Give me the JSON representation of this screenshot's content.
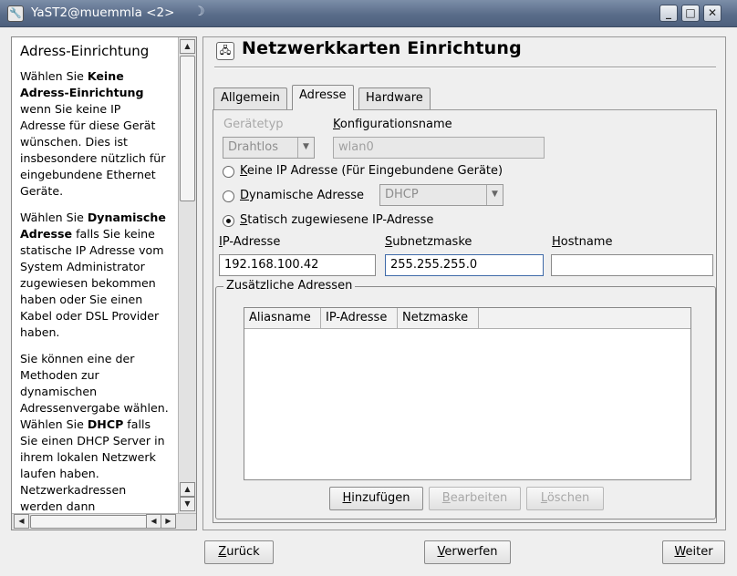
{
  "window": {
    "title": "YaST2@muemmla <2>",
    "app_icon": "yast-icon",
    "controls": {
      "minimize": "_",
      "maximize": "□",
      "close": "✕"
    }
  },
  "help": {
    "title": "Adress-Einrichtung",
    "p1_a": "Wählen Sie ",
    "p1_b": "Keine Adress-Einrichtung",
    "p1_c": " wenn Sie keine IP Adresse für diese Gerät wünschen. Dies ist insbesondere nützlich für eingebundene Ethernet Geräte.",
    "p2_a": "Wählen Sie ",
    "p2_b": "Dynamische Adresse",
    "p2_c": " falls Sie keine statische IP Adresse vom System Administrator zugewiesen bekommen haben oder Sie einen Kabel oder DSL Provider haben.",
    "p3_a": "Sie können eine der Methoden zur dynamischen Adressenvergabe wählen. Wählen Sie ",
    "p3_b": "DHCP",
    "p3_c": " falls Sie einen DHCP Server in ihrem lokalen Netzwerk laufen haben. Netzwerkadressen werden dann automatisch vom Server bezogen."
  },
  "main": {
    "title": "Netzwerkkarten Einrichtung",
    "tabs": [
      {
        "label": "Allgemein",
        "active": false
      },
      {
        "label": "Adresse",
        "active": true
      },
      {
        "label": "Hardware",
        "active": false
      }
    ],
    "device_type": {
      "label": "Gerätetyp",
      "value": "Drahtlos"
    },
    "config_name": {
      "label_mn": "K",
      "label_rest": "onfigurationsname",
      "value": "wlan0"
    },
    "radios": {
      "none": {
        "mn": "K",
        "rest": "eine IP Adresse (Für Eingebundene Geräte)",
        "checked": false
      },
      "dynamic": {
        "mn": "D",
        "rest": "ynamische Adresse",
        "checked": false,
        "method": "DHCP"
      },
      "static": {
        "mn": "S",
        "rest": "tatisch zugewiesene IP-Adresse",
        "checked": true
      }
    },
    "ip": {
      "label_mn": "I",
      "label_rest": "P-Adresse",
      "value": "192.168.100.42"
    },
    "netmask": {
      "label_mn": "S",
      "label_rest": "ubnetzmaske",
      "value": "255.255.255.0"
    },
    "hostname": {
      "label_mn": "H",
      "label_rest": "ostname",
      "value": ""
    },
    "extra": {
      "title": "Zusätzliche Adressen",
      "columns": [
        "Aliasname",
        "IP-Adresse",
        "Netzmaske"
      ],
      "rows": [],
      "add": {
        "mn": "H",
        "rest": "inzufügen"
      },
      "edit": {
        "mn": "B",
        "rest": "earbeiten"
      },
      "delete": {
        "mn": "L",
        "rest": "öschen"
      }
    }
  },
  "footer": {
    "back": {
      "mn": "Z",
      "rest": "urück"
    },
    "abort": {
      "mn": "V",
      "rest": "erwerfen"
    },
    "next": {
      "mn": "W",
      "rest": "eiter"
    }
  }
}
